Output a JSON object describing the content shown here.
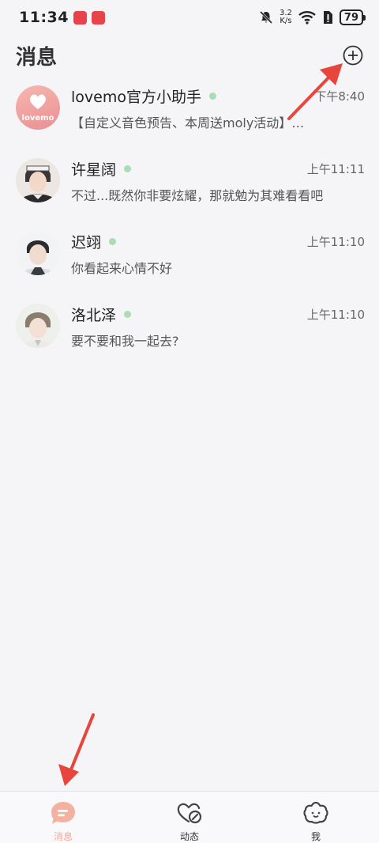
{
  "status_bar": {
    "time": "11:34",
    "speed_value": "3.2",
    "speed_unit": "K/s",
    "battery": "79"
  },
  "header": {
    "title": "消息"
  },
  "conversations": [
    {
      "name": "lovemo官方小助手",
      "time": "下午8:40",
      "preview": "【自定义音色预告、本周送moly活动】…",
      "avatar_text": "lovemo",
      "online": true
    },
    {
      "name": "许星阔",
      "time": "上午11:11",
      "preview": "不过...既然你非要炫耀，那就勉为其难看看吧",
      "online": true
    },
    {
      "name": "迟翊",
      "time": "上午11:10",
      "preview": "你看起来心情不好",
      "online": true
    },
    {
      "name": "洛北泽",
      "time": "上午11:10",
      "preview": "要不要和我一起去?",
      "online": true
    }
  ],
  "tabs": [
    {
      "label": "消息",
      "icon": "chat-bubble-icon",
      "active": true
    },
    {
      "label": "动态",
      "icon": "moments-icon",
      "active": false
    },
    {
      "label": "我",
      "icon": "profile-icon",
      "active": false
    }
  ],
  "colors": {
    "accent": "#f2a898",
    "online": "#a8ddb5",
    "annotation_arrow": "#e8453c"
  }
}
